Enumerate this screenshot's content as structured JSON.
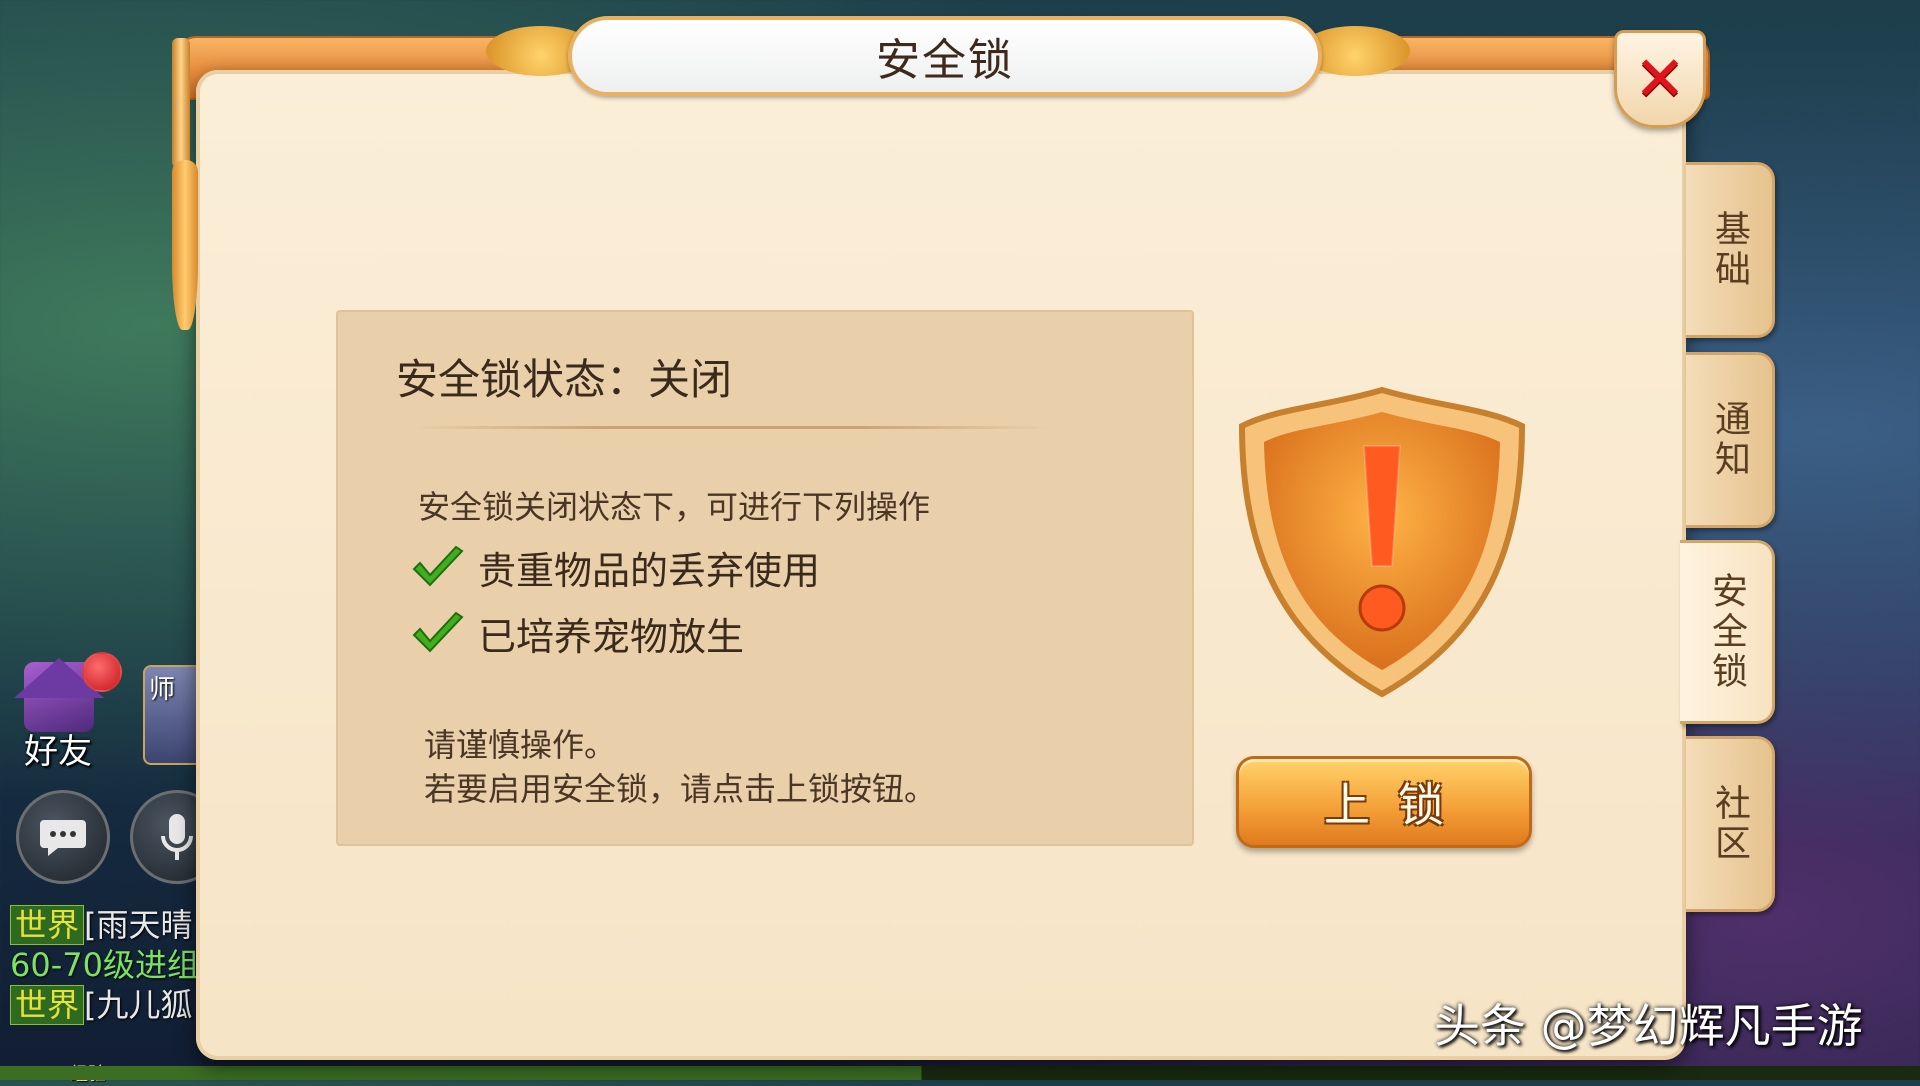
{
  "dialog": {
    "title": "安全锁",
    "close_symbol": "✕"
  },
  "status": {
    "title": "安全锁状态：关闭",
    "description": "安全锁关闭状态下，可进行下列操作",
    "allowed_actions": [
      "贵重物品的丢弃使用",
      "已培养宠物放生"
    ],
    "note_line1": "请谨慎操作。",
    "note_line2": "若要启用安全锁，请点击上锁按钮。"
  },
  "shield": {
    "icon": "warning-shield-icon",
    "accent": "#e8862a"
  },
  "lock_button": {
    "label": "上锁"
  },
  "tabs": [
    {
      "label": "基础",
      "active": false
    },
    {
      "label": "通知",
      "active": false
    },
    {
      "label": "安全锁",
      "active": true
    },
    {
      "label": "社区",
      "active": false
    }
  ],
  "hud": {
    "friend_label": "好友",
    "master_label": "师",
    "chat": [
      {
        "tag": "世界",
        "text": "[雨天晴"
      },
      {
        "tag": "",
        "text": "60-70级进组"
      },
      {
        "tag": "世界",
        "text": "[九儿狐"
      }
    ],
    "exp_label": "经验"
  },
  "watermark": "头条 @梦幻辉凡手游",
  "colors": {
    "panel": "#e9d0ab",
    "dialog": "#fbeed8",
    "close_x": "#e0141b",
    "button": "#f5a23a"
  }
}
